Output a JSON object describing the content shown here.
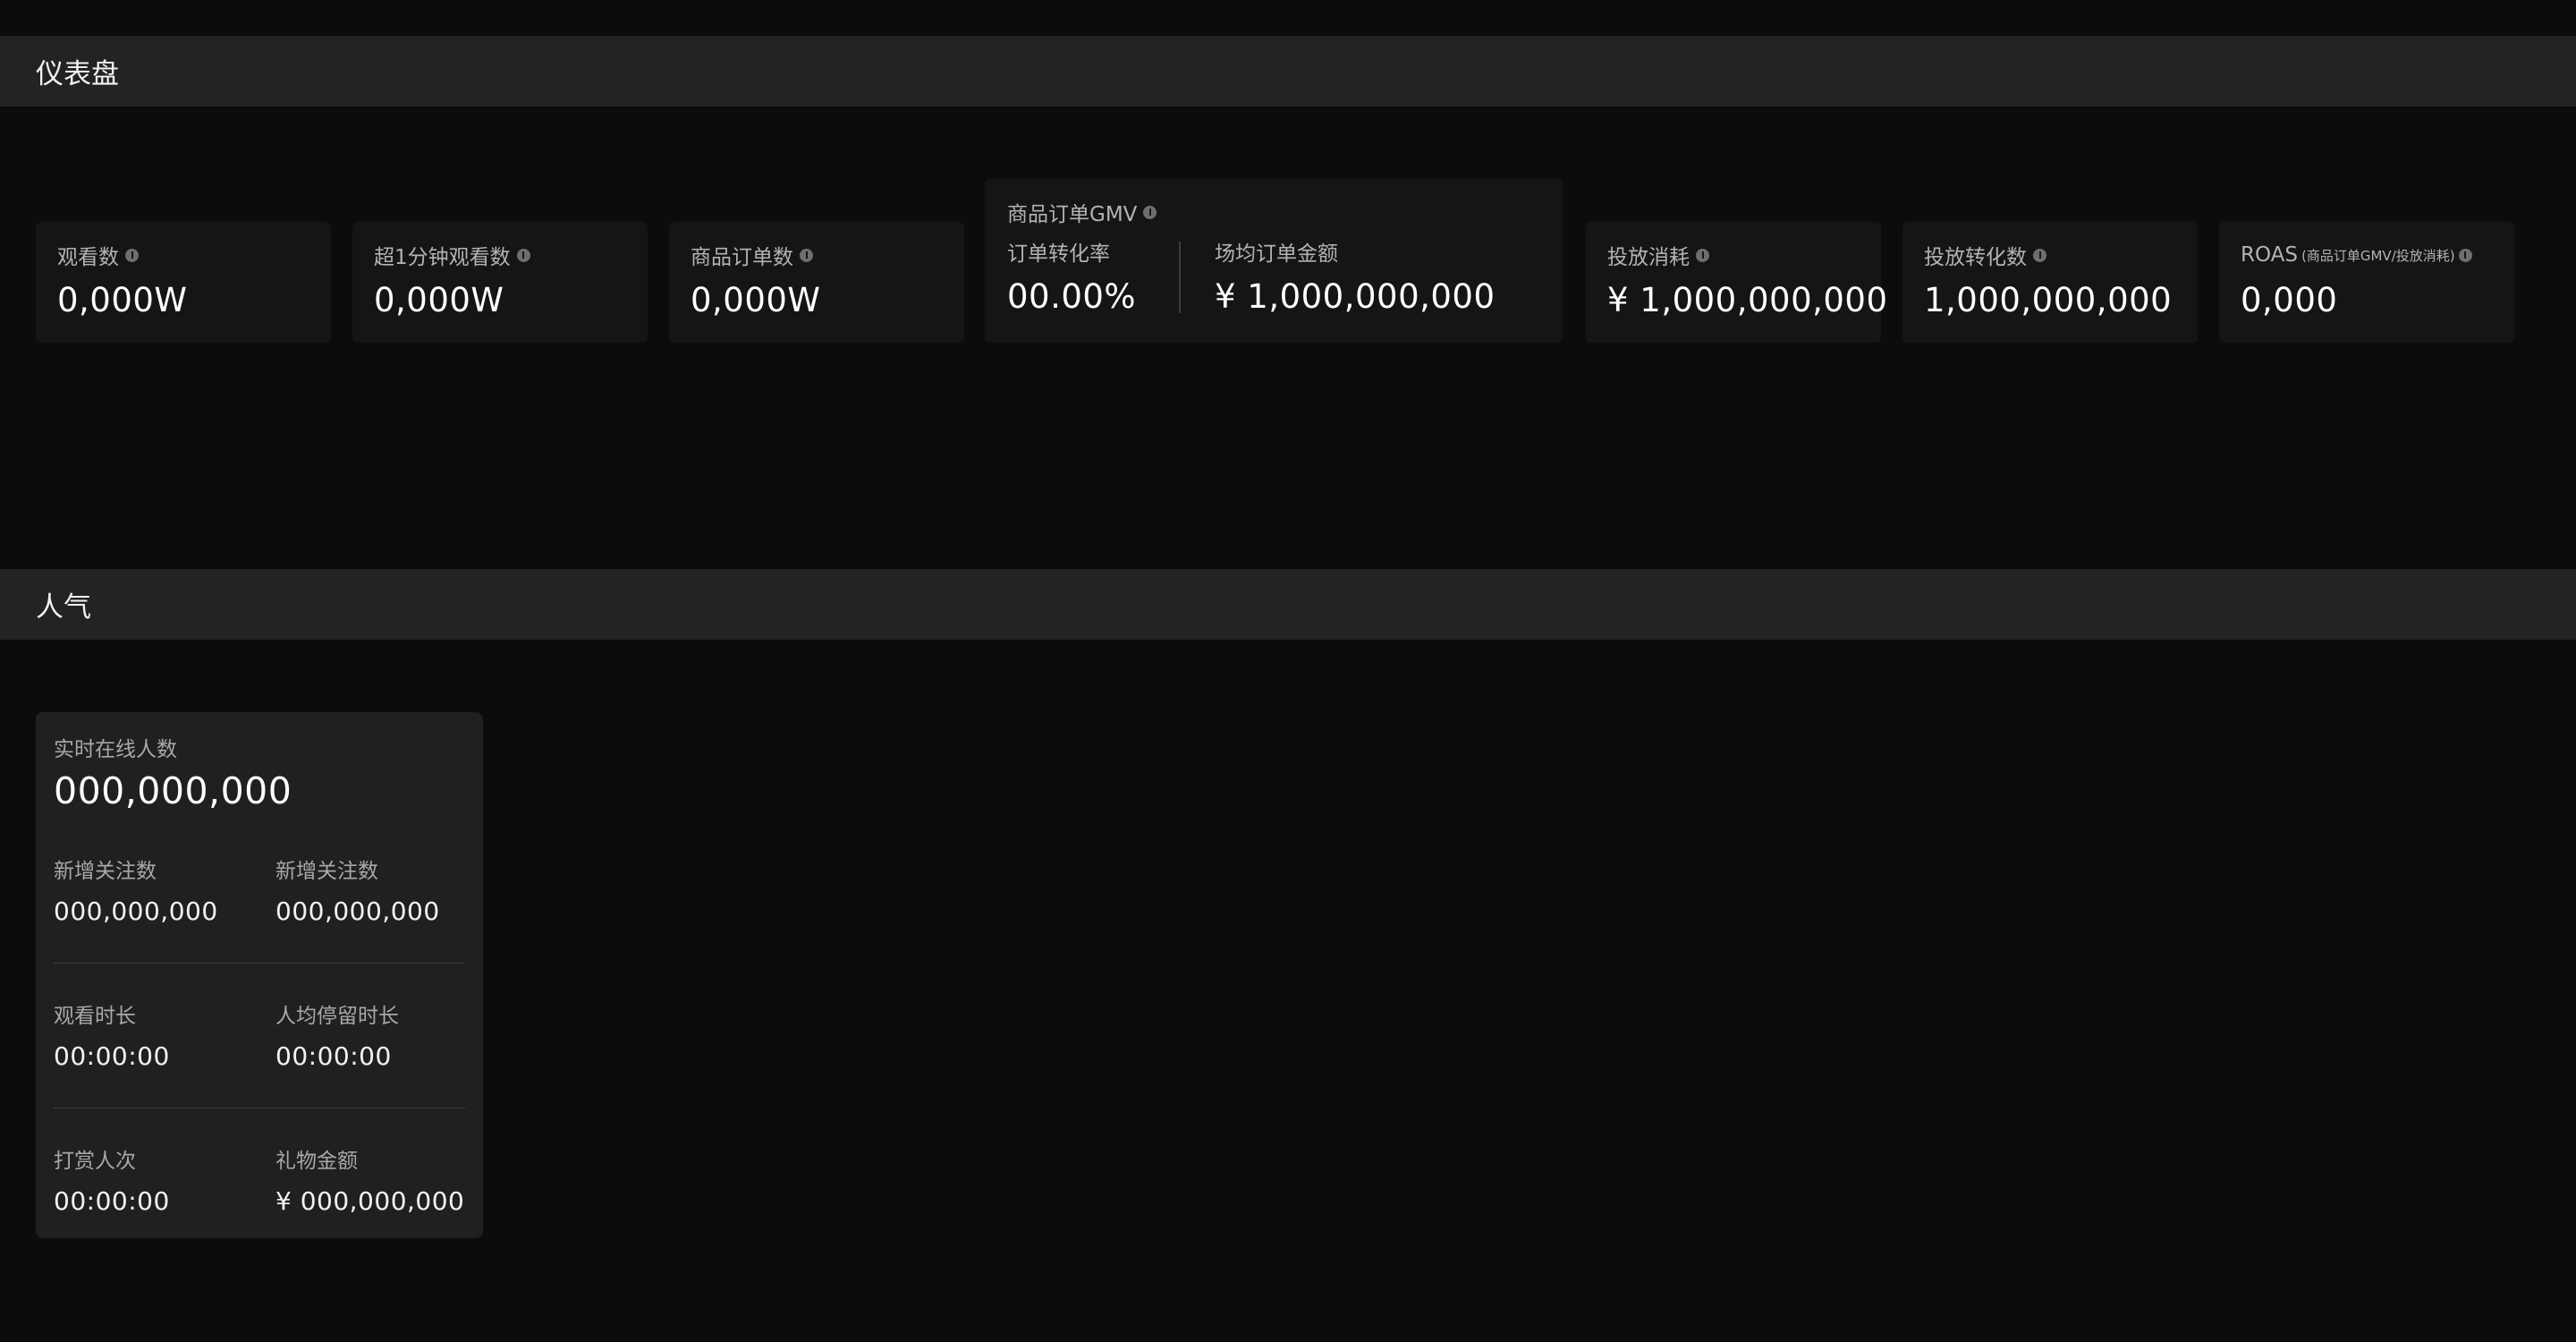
{
  "sections": {
    "dashboard_title": "仪表盘",
    "popularity_title": "人气"
  },
  "metrics": [
    {
      "label": "观看数",
      "value": "0,000W"
    },
    {
      "label": "超1分钟观看数",
      "value": "0,000W"
    },
    {
      "label": "商品订单数",
      "value": "0,000W"
    },
    {
      "label": "投放消耗",
      "value": "¥ 1,000,000,000"
    },
    {
      "label": "投放转化数",
      "value": "1,000,000,000"
    },
    {
      "label": "ROAS",
      "label_sub": "(商品订单GMV/投放消耗)",
      "value": "0,000"
    }
  ],
  "gmv": {
    "title": "商品订单GMV",
    "conversion_label": "订单转化率",
    "conversion_value": "00.00%",
    "avg_amount_label": "场均订单金额",
    "avg_amount_value": "¥ 1,000,000,000"
  },
  "popularity": {
    "online_label": "实时在线人数",
    "online_value": "000,000,000",
    "items": [
      {
        "label": "新增关注数",
        "value": "000,000,000"
      },
      {
        "label": "新增关注数",
        "value": "000,000,000"
      },
      {
        "label": "观看时长",
        "value": "00:00:00"
      },
      {
        "label": "人均停留时长",
        "value": "00:00:00"
      },
      {
        "label": "打赏人次",
        "value": "00:00:00"
      },
      {
        "label": "礼物金额",
        "value": "¥ 000,000,000"
      }
    ]
  },
  "icons": {
    "info": "info-icon"
  },
  "colors": {
    "background": "#0c0c0c",
    "header": "#232323",
    "card": "#151517",
    "popularity_card": "#202022",
    "label": "#b3b3b3",
    "value": "#ffffff"
  }
}
